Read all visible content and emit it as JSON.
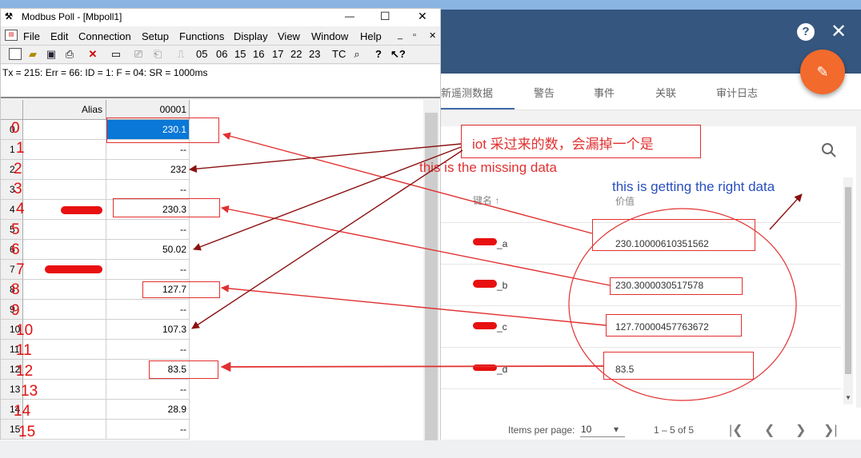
{
  "app": {
    "tabs": [
      "新遥测数据",
      "警告",
      "事件",
      "关联",
      "审计日志"
    ],
    "header_help": "?",
    "header_close": "✕",
    "fab_icon": "✎",
    "table_header_key": "键名 ↑",
    "table_header_value": "价值",
    "rows": [
      {
        "key": "_a",
        "value": "230.10000610351562"
      },
      {
        "key": "_b",
        "value": "230.3000030517578"
      },
      {
        "key": "_c",
        "value": "127.70000457763672"
      },
      {
        "key": "_d",
        "value": "83.5"
      }
    ],
    "pager": {
      "items_per_page_label": "Items per page:",
      "items_per_page_value": "10",
      "range": "1 – 5 of 5"
    }
  },
  "modbus": {
    "title": "Modbus Poll - [Mbpoll1]",
    "win_min": "—",
    "win_max": "☐",
    "win_close": "✕",
    "menu": [
      "File",
      "Edit",
      "Connection",
      "Setup",
      "Functions",
      "Display",
      "View",
      "Window",
      "Help"
    ],
    "mdi_buttons": [
      "_",
      "▫",
      "✕"
    ],
    "toolbar_codes": [
      "05",
      "06",
      "15",
      "16",
      "17",
      "22",
      "23",
      "TC"
    ],
    "status_line": "Tx = 215: Err = 66: ID = 1: F = 04: SR = 1000ms",
    "col_alias": "Alias",
    "col_address": "00001",
    "rows": [
      {
        "n": "0",
        "v": "230.1"
      },
      {
        "n": "1",
        "v": "--"
      },
      {
        "n": "2",
        "v": "232"
      },
      {
        "n": "3",
        "v": "--"
      },
      {
        "n": "4",
        "v": "230.3"
      },
      {
        "n": "5",
        "v": "--"
      },
      {
        "n": "6",
        "v": "50.02"
      },
      {
        "n": "7",
        "v": "--"
      },
      {
        "n": "8",
        "v": "127.7"
      },
      {
        "n": "9",
        "v": "--"
      },
      {
        "n": "10",
        "v": "107.3"
      },
      {
        "n": "11",
        "v": "--"
      },
      {
        "n": "12",
        "v": "83.5"
      },
      {
        "n": "13",
        "v": "--"
      },
      {
        "n": "14",
        "v": "28.9"
      },
      {
        "n": "15",
        "v": "--"
      }
    ],
    "row_index_overlay": [
      "0",
      "1",
      "2",
      "3",
      "4",
      "5",
      "6",
      "7",
      "8",
      "9",
      "10",
      "11",
      "12",
      "13",
      "14",
      "15"
    ]
  },
  "annotations": {
    "chinese_note": "iot 采过来的数，会漏掉一个是",
    "missing_note": "this is the missing data",
    "right_note": "this is getting the right data"
  },
  "colors": {
    "header": "#34567f",
    "fab": "#f26a2c",
    "annotation_red": "#e23030",
    "annotation_blue": "#2a4fbf",
    "arrow_dark": "#8b1010"
  }
}
